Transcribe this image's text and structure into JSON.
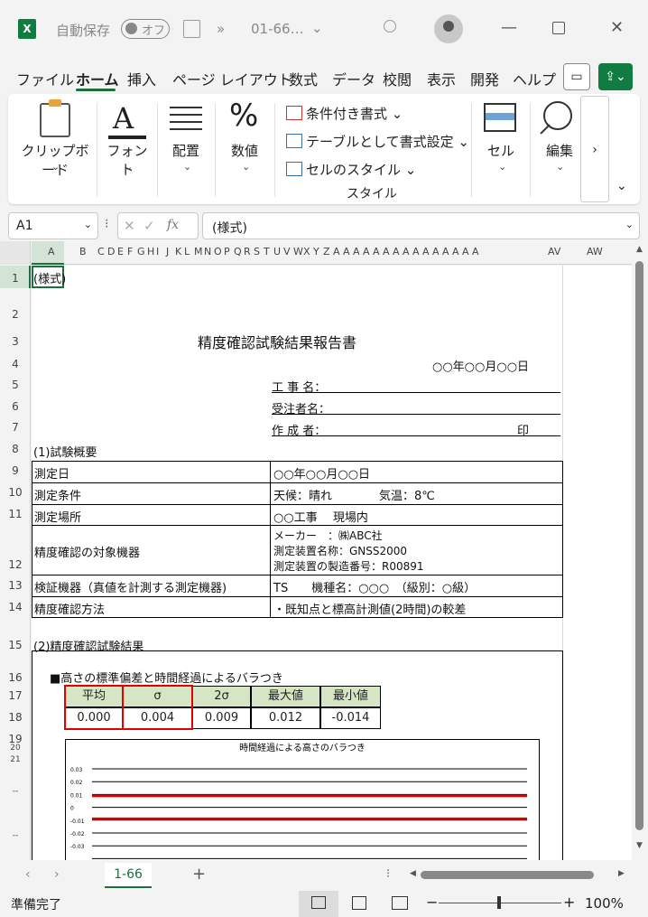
{
  "titlebar": {
    "app_icon": "excel-icon",
    "autosave_label": "自動保存",
    "autosave_state": "オフ",
    "file_name": "01-66…",
    "more": "»"
  },
  "menu": {
    "tabs": [
      "ファイル",
      "ホーム",
      "挿入",
      "ページ レイアウト",
      "数式",
      "データ",
      "校閲",
      "表示",
      "開発",
      "ヘルプ"
    ],
    "active": "ホーム"
  },
  "ribbon": {
    "clipboard": "クリップボード",
    "font": "フォント",
    "alignment": "配置",
    "number": "数値",
    "conditional_format": "条件付き書式",
    "table_format": "テーブルとして書式設定",
    "cell_styles": "セルのスタイル",
    "styles_group": "スタイル",
    "cells": "セル",
    "editing": "編集",
    "more": "›"
  },
  "formula_bar": {
    "name_box": "A1",
    "content": "(様式)",
    "fx": "fx"
  },
  "columns": [
    "A",
    "B",
    "C",
    "D",
    "E",
    "F",
    "G",
    "H",
    "I",
    "J",
    "K",
    "L",
    "M",
    "N",
    "O",
    "P",
    "Q",
    "R",
    "S",
    "T",
    "U",
    "V",
    "W",
    "X",
    "Y",
    "Z",
    "A",
    "A",
    "A",
    "A",
    "A",
    "A",
    "A",
    "A",
    "A",
    "A",
    "A",
    "A",
    "A",
    "A",
    "A",
    "AV",
    "AW"
  ],
  "rows": [
    "1",
    "2",
    "3",
    "4",
    "5",
    "6",
    "7",
    "8",
    "9",
    "10",
    "11",
    "12",
    "13",
    "14",
    "15",
    "16",
    "17",
    "18",
    "19",
    "20",
    "21",
    "--",
    "--"
  ],
  "sheet": {
    "r1": "(様式)",
    "title": "精度確認試験結果報告書",
    "date": "○○年○○月○○日",
    "koji": "工 事 名：",
    "jucyu": "受注者名：",
    "sakusei": "作 成 者：",
    "in": "印",
    "sec1": "(1)試験概要",
    "rows": [
      {
        "label": "測定日",
        "value": "○○年○○月○○日"
      },
      {
        "label": "測定条件",
        "value": "天候：晴れ　　　　気温：8℃"
      },
      {
        "label": "測定場所",
        "value": "○○工事　 現場内"
      },
      {
        "label": "精度確認の対象機器",
        "value1": "メーカー　：㈱ABC社",
        "value2": "測定装置名称：GNSS2000",
        "value3": "測定装置の製造番号：R00891"
      },
      {
        "label": "検証機器（真値を計測する測定機器)",
        "value": "TS　　機種名：○○○　（級別：○級）"
      },
      {
        "label": "精度確認方法",
        "value": "・既知点と標高計測値(2時間)の較差"
      }
    ],
    "sec2": "(2)精度確認試験結果",
    "subhead": "■高さの標準偏差と時間経過によるバラつき",
    "stats_headers": [
      "平均",
      "σ",
      "2σ",
      "最大値",
      "最小値"
    ],
    "stats_values": [
      "0.000",
      "0.004",
      "0.009",
      "0.012",
      "-0.014"
    ]
  },
  "chart_data": {
    "type": "line",
    "title": "時間経過による高さのバラつき",
    "yticks": [
      "0.03",
      "0.02",
      "0.01",
      "0",
      "-0.01",
      "-0.02",
      "-0.03"
    ],
    "ylim": [
      -0.03,
      0.03
    ],
    "reference_lines": [
      {
        "name": "",
        "y": 0.009,
        "color": "#e00000"
      },
      {
        "name": "",
        "y": -0.009,
        "color": "#e00000"
      }
    ],
    "grid": true
  },
  "tabs": {
    "sheet_name": "1-66",
    "add": "+"
  },
  "status": {
    "ready": "準備完了",
    "zoom": "100%",
    "minus": "−",
    "plus": "+"
  }
}
